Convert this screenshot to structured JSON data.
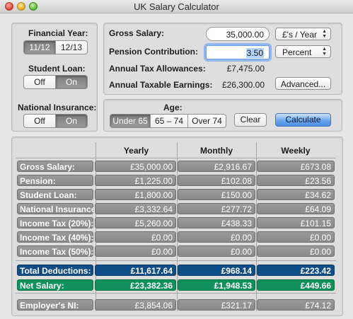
{
  "window": {
    "title": "UK Salary Calculator"
  },
  "left_panel": {
    "financial_year_label": "Financial Year:",
    "financial_year_options": [
      "11/12",
      "12/13"
    ],
    "financial_year_selected": "11/12",
    "student_loan_label": "Student Loan:",
    "student_loan_options": [
      "Off",
      "On"
    ],
    "student_loan_selected": "On",
    "national_insurance_label": "National Insurance:",
    "national_insurance_options": [
      "Off",
      "On"
    ],
    "national_insurance_selected": "On"
  },
  "inputs": {
    "gross_salary_label": "Gross Salary:",
    "gross_salary_value": "35,000.00",
    "gross_salary_unit": "£'s / Year",
    "pension_label": "Pension Contribution:",
    "pension_value": "3.50",
    "pension_unit": "Percent",
    "allowances_label": "Annual Tax Allowances:",
    "allowances_value": "£7,475.00",
    "taxable_label": "Annual Taxable Earnings:",
    "taxable_value": "£26,300.00",
    "advanced_button": "Advanced..."
  },
  "age": {
    "label": "Age:",
    "options": [
      "Under 65",
      "65 – 74",
      "Over 74"
    ],
    "selected": "Under 65",
    "clear_button": "Clear",
    "calculate_button": "Calculate"
  },
  "table": {
    "headers": [
      "Yearly",
      "Monthly",
      "Weekly"
    ],
    "rows": [
      {
        "name": "Gross Salary:",
        "yearly": "£35,000.00",
        "monthly": "£2,916.67",
        "weekly": "£673.08"
      },
      {
        "name": "Pension:",
        "yearly": "£1,225.00",
        "monthly": "£102.08",
        "weekly": "£23.56"
      },
      {
        "name": "Student Loan:",
        "yearly": "£1,800.00",
        "monthly": "£150.00",
        "weekly": "£34.62"
      },
      {
        "name": "National Insurance:",
        "yearly": "£3,332.64",
        "monthly": "£277.72",
        "weekly": "£64.09"
      },
      {
        "name": "Income Tax (20%):",
        "yearly": "£5,260.00",
        "monthly": "£438.33",
        "weekly": "£101.15"
      },
      {
        "name": "Income Tax (40%):",
        "yearly": "£0.00",
        "monthly": "£0.00",
        "weekly": "£0.00"
      },
      {
        "name": "Income Tax (50%):",
        "yearly": "£0.00",
        "monthly": "£0.00",
        "weekly": "£0.00"
      }
    ],
    "total_deductions": {
      "name": "Total Deductions:",
      "yearly": "£11,617.64",
      "monthly": "£968.14",
      "weekly": "£223.42"
    },
    "net_salary": {
      "name": "Net Salary:",
      "yearly": "£23,382.36",
      "monthly": "£1,948.53",
      "weekly": "£449.66"
    },
    "employers_ni": {
      "name": "Employer's NI:",
      "yearly": "£3,854.06",
      "monthly": "£321.17",
      "weekly": "£74.12"
    }
  },
  "colors": {
    "total_bar": "#0e4d86",
    "net_bar": "#11915b",
    "row_bar": "#8f8f8f",
    "primary_button": "#4c8fe4"
  }
}
